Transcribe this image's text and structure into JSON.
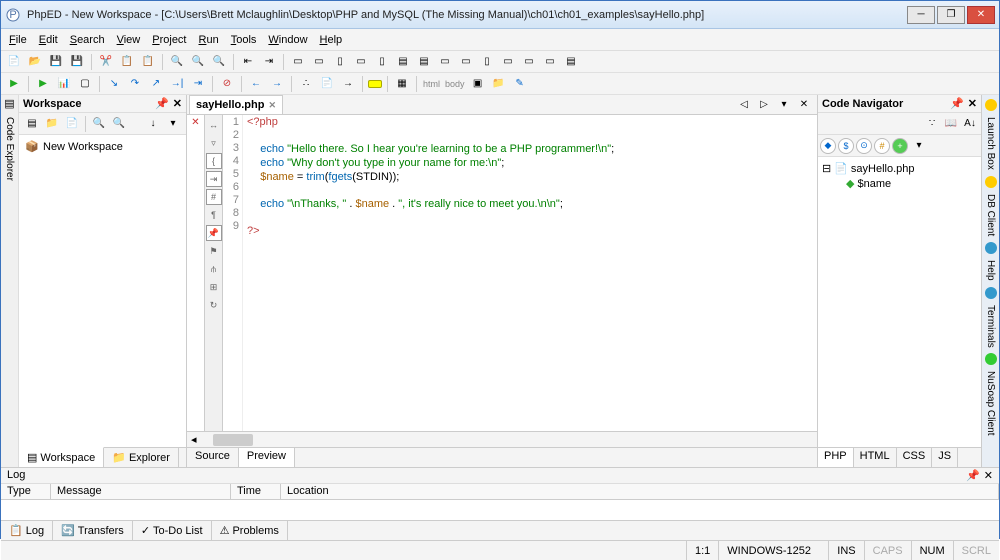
{
  "window": {
    "title": "PhpED - New Workspace - [C:\\Users\\Brett Mclaughlin\\Desktop\\PHP and MySQL (The Missing Manual)\\ch01\\ch01_examples\\sayHello.php]"
  },
  "menu": [
    "File",
    "Edit",
    "Search",
    "View",
    "Project",
    "Run",
    "Tools",
    "Window",
    "Help"
  ],
  "workspace_panel": {
    "title": "Workspace",
    "root": "New Workspace",
    "tabs": [
      "Workspace",
      "Explorer"
    ]
  },
  "editor": {
    "tab": "sayHello.php",
    "lines": [
      "1",
      "2",
      "3",
      "4",
      "5",
      "6",
      "7",
      "8",
      "9"
    ],
    "bottom_tabs": [
      "Source",
      "Preview"
    ]
  },
  "code": {
    "open": "<?php",
    "l3a": "echo ",
    "l3b": "\"Hello there. So I hear you're learning to be a PHP programmer!\\n\"",
    "l3c": ";",
    "l4a": "echo ",
    "l4b": "\"Why don't you type in your name for me:\\n\"",
    "l4c": ";",
    "l5a": "$name",
    "l5b": " = ",
    "l5c": "trim",
    "l5d": "(",
    "l5e": "fgets",
    "l5f": "(",
    "l5g": "STDIN",
    "l5h": "));",
    "l7a": "echo ",
    "l7b": "\"\\nThanks, \"",
    "l7c": " . ",
    "l7d": "$name",
    "l7e": " . ",
    "l7f": "\", it's really nice to meet you.\\n\\n\"",
    "l7g": ";",
    "close": "?>"
  },
  "nav": {
    "title": "Code Navigator",
    "file": "sayHello.php",
    "var": "$name",
    "langs": [
      "PHP",
      "HTML",
      "CSS",
      "JS"
    ]
  },
  "right_rail": [
    "Launch Box",
    "DB Client",
    "Help",
    "Terminals",
    "NuSoap Client"
  ],
  "log": {
    "title": "Log",
    "cols": {
      "type": "Type",
      "message": "Message",
      "time": "Time",
      "location": "Location"
    },
    "tabs": [
      "Log",
      "Transfers",
      "To-Do List",
      "Problems"
    ]
  },
  "status": {
    "pos": "1:1",
    "enc": "WINDOWS-1252",
    "ins": "INS",
    "caps": "CAPS",
    "num": "NUM",
    "scrl": "SCRL"
  },
  "tb_text": {
    "html": "html",
    "body": "body"
  },
  "left_rail_explorer": "Code Explorer"
}
